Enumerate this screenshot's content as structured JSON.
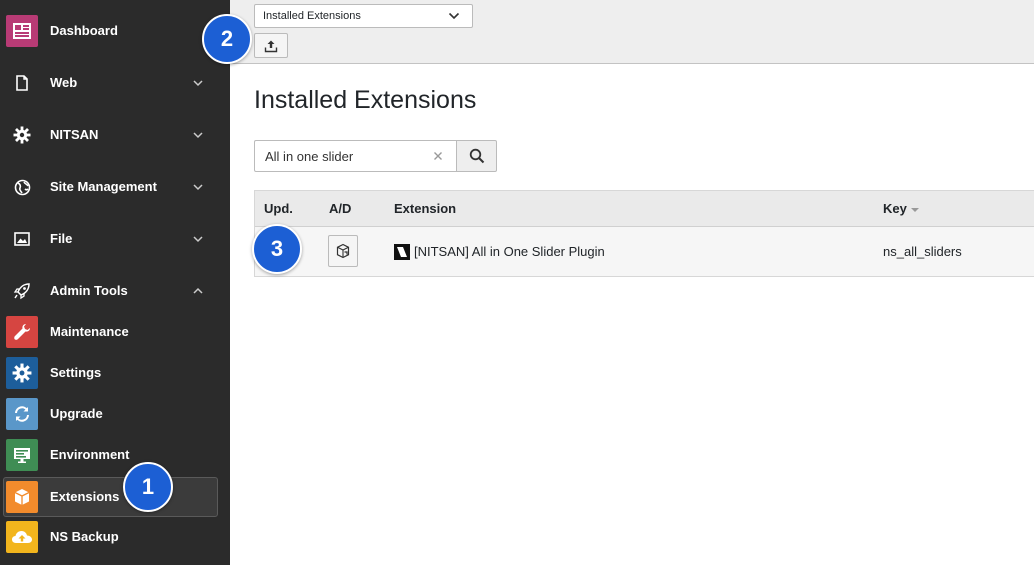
{
  "colors": {
    "sidebar_bg": "#2b2b2b",
    "badge_blue": "#1c5fd4",
    "maintenance_tile": "#d64541",
    "settings_tile": "#1d5e9b",
    "upgrade_tile": "#5a97c9",
    "environment_tile": "#3f8d54",
    "extensions_tile": "#f28b2c",
    "ns_backup_tile": "#f2b51d",
    "dashboard_tile": "#b83b75"
  },
  "sidebar": {
    "items": [
      {
        "label": "Dashboard",
        "icon": "dashboard-icon"
      },
      {
        "label": "Web",
        "icon": "page-icon"
      },
      {
        "label": "NITSAN",
        "icon": "gear-icon"
      },
      {
        "label": "Site Management",
        "icon": "globe-icon"
      },
      {
        "label": "File",
        "icon": "image-icon"
      },
      {
        "label": "Admin Tools",
        "icon": "rocket-icon"
      },
      {
        "label": "Maintenance",
        "icon": "wrench-icon"
      },
      {
        "label": "Settings",
        "icon": "gear-icon"
      },
      {
        "label": "Upgrade",
        "icon": "refresh-icon"
      },
      {
        "label": "Environment",
        "icon": "monitor-icon"
      },
      {
        "label": "Extensions",
        "icon": "cube-icon",
        "active": true
      },
      {
        "label": "NS Backup",
        "icon": "cloud-upload-icon"
      }
    ]
  },
  "topbar": {
    "module_select_value": "Installed Extensions",
    "upload_icon": "upload-icon"
  },
  "main": {
    "title": "Installed Extensions",
    "search": {
      "value": "All in one slider",
      "search_icon": "search-icon"
    },
    "table": {
      "columns": [
        "Upd.",
        "A/D",
        "Extension",
        "Key"
      ],
      "rows": [
        {
          "extension": "[NITSAN] All in One Slider Plugin",
          "key": "ns_all_sliders"
        }
      ]
    }
  },
  "callouts": [
    "1",
    "2",
    "3"
  ]
}
